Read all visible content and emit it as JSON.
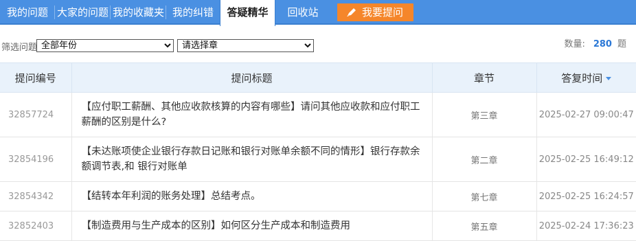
{
  "tabs": [
    {
      "label": "我的问题"
    },
    {
      "label": "大家的问题"
    },
    {
      "label": "我的收藏夹"
    },
    {
      "label": "我的纠错"
    },
    {
      "label": "答疑精华"
    },
    {
      "label": "回收站"
    }
  ],
  "ask_button": {
    "label": "我要提问",
    "icon": "pencil-icon"
  },
  "filter": {
    "label": "筛选问题",
    "year_select": {
      "selected": "全部年份"
    },
    "chapter_select": {
      "selected": "请选择章"
    }
  },
  "count": {
    "label": "数量:",
    "value": "280",
    "unit": "题"
  },
  "table": {
    "headers": {
      "id": "提问编号",
      "title": "提问标题",
      "chapter": "章节",
      "time": "答复时间"
    },
    "rows": [
      {
        "id": "32857724",
        "title": "【应付职工薪酬、其他应收款核算的内容有哪些】请问其他应收款和应付职工薪酬的区别是什么?",
        "chapter": "第三章",
        "time": "2025-02-27 09:00:47"
      },
      {
        "id": "32854196",
        "title": "【未达账项使企业银行存款日记账和银行对账单余额不同的情形】银行存款余额调节表,和 银行对账单",
        "chapter": "第二章",
        "time": "2025-02-25 16:49:12"
      },
      {
        "id": "32854342",
        "title": "【结转本年利润的账务处理】总结考点。",
        "chapter": "第七章",
        "time": "2025-02-25 16:24:57"
      },
      {
        "id": "32852403",
        "title": "【制造费用与生产成本的区别】如何区分生产成本和制造费用",
        "chapter": "第五章",
        "time": "2025-02-24 17:36:23"
      }
    ]
  },
  "colors": {
    "tab_bar": "#4a90e2",
    "ask_button": "#f5862a",
    "count_accent": "#2b78d6",
    "header_bg": "#e9f2fb"
  }
}
